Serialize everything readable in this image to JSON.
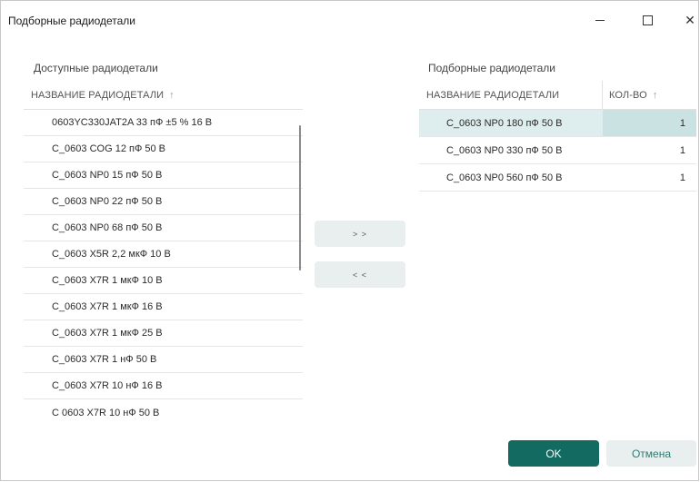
{
  "window": {
    "title": "Подборные радиодетали",
    "controls": {
      "minimize": "minimize-icon",
      "maximize": "maximize-icon",
      "close": "close-icon"
    }
  },
  "available": {
    "title": "Доступные радиодетали",
    "column_header": "НАЗВАНИЕ РАДИОДЕТАЛИ",
    "sort_indicator": "↑",
    "items": [
      "0603YC330JAT2A 33 пФ ±5 % 16 В",
      "C_0603 COG 12 пФ 50 В",
      "C_0603 NP0 15 пФ 50 В",
      "C_0603 NP0 22 пФ 50 В",
      "C_0603 NP0 68 пФ 50 В",
      "C_0603 X5R 2,2 мкФ 10 В",
      "C_0603 X7R 1 мкФ 10 В",
      "C_0603 X7R 1 мкФ 16 В",
      "C_0603 X7R 1 мкФ 25 В",
      "C_0603 X7R 1 нФ 50 В",
      "C_0603 X7R 10 нФ 16 В",
      "C 0603 X7R 10 нФ 50 В"
    ]
  },
  "transfer": {
    "add_label": "> >",
    "remove_label": "< <"
  },
  "selected": {
    "title": "Подборные радиодетали",
    "columns": {
      "name": "НАЗВАНИЕ РАДИОДЕТАЛИ",
      "qty": "КОЛ-ВО",
      "sort_indicator": "↑"
    },
    "rows": [
      {
        "name": "C_0603 NP0 180 пФ 50 В",
        "qty": "1"
      },
      {
        "name": "C_0603 NP0 330 пФ 50 В",
        "qty": "1"
      },
      {
        "name": "C_0603 NP0 560 пФ 50 В",
        "qty": "1"
      }
    ],
    "selected_index": 0
  },
  "footer": {
    "ok_label": "OK",
    "cancel_label": "Отмена"
  },
  "colors": {
    "accent": "#136a60",
    "selection": "#deeeee",
    "button_secondary": "#e9eeee"
  }
}
